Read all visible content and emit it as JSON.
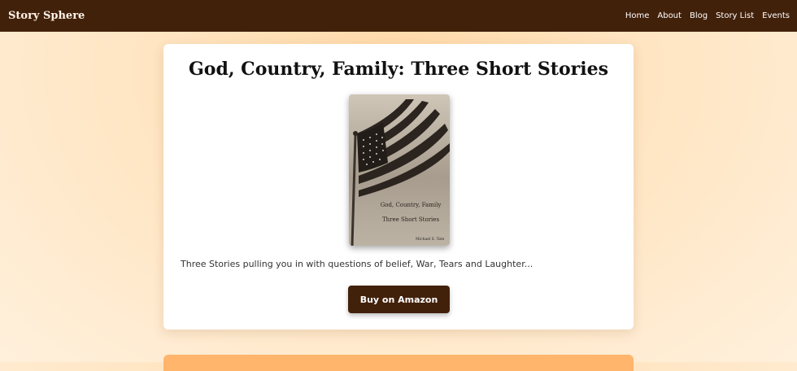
{
  "nav": {
    "brand": "Story Sphere",
    "links": [
      "Home",
      "About",
      "Blog",
      "Story List",
      "Events"
    ]
  },
  "book": {
    "title": "God, Country, Family: Three Short Stories",
    "cover": {
      "line1": "God, Country, Family",
      "line2": "Three Short Stories",
      "author": "Michael S. Tate"
    },
    "description": "Three Stories pulling you in with questions of belief, War, Tears and Laughter...",
    "buy_label": "Buy on Amazon"
  },
  "colors": {
    "nav_bg": "#42210b",
    "button_bg": "#42210b",
    "next_card": "#ffb56b"
  }
}
